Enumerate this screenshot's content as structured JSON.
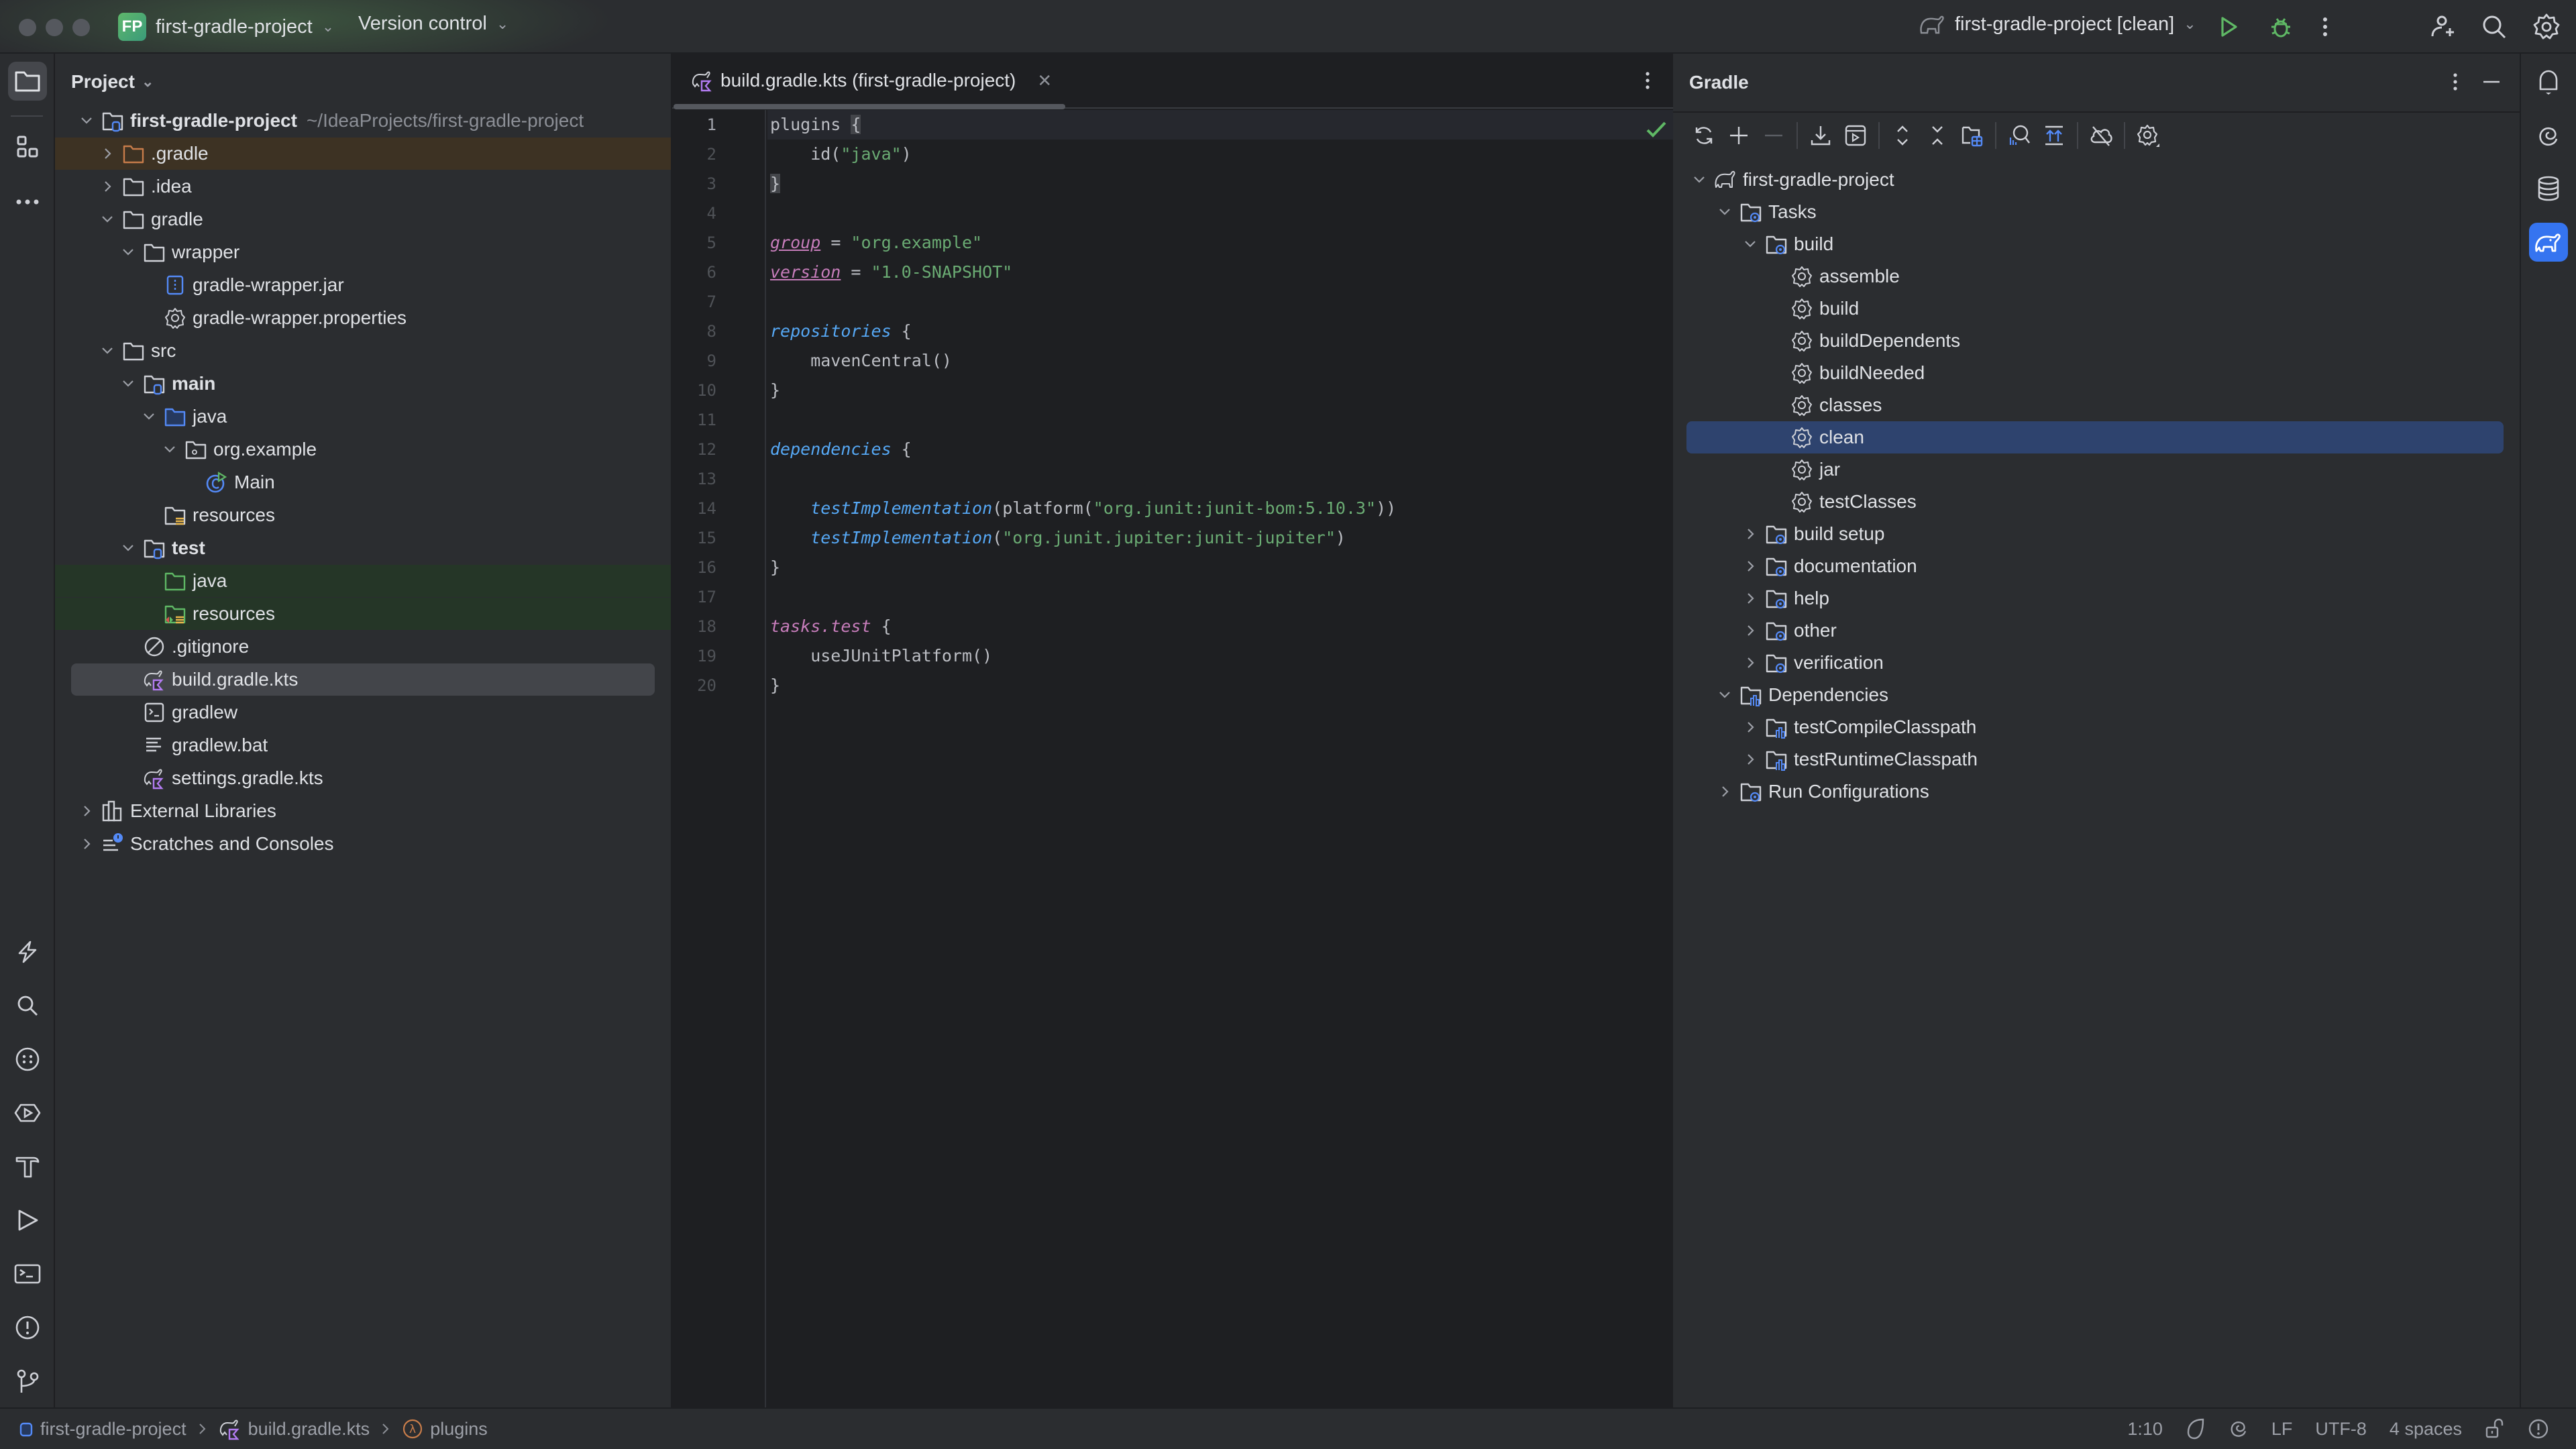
{
  "titlebar": {
    "project_badge": "FP",
    "project_name": "first-gradle-project",
    "vcs_label": "Version control",
    "run_config": "first-gradle-project [clean]",
    "colors": {
      "run": "#5fb865",
      "debug": "#5fb865"
    }
  },
  "left_stripe": {
    "top": [
      "project-icon",
      "structure-icon",
      "more-icon"
    ],
    "bottom": [
      "lightning-icon",
      "search-icon",
      "services-icon",
      "run-services-icon",
      "build-icon",
      "run-icon",
      "terminal-icon",
      "problems-icon",
      "git-icon"
    ]
  },
  "project_panel": {
    "title": "Project",
    "tree": [
      {
        "label": "first-gradle-project",
        "hint": "~/IdeaProjects/first-gradle-project",
        "level": 0,
        "arrow": "down",
        "icon": "module-folder",
        "bold": true
      },
      {
        "label": ".gradle",
        "level": 1,
        "arrow": "right",
        "icon": "folder-excluded",
        "state": "excluded"
      },
      {
        "label": ".idea",
        "level": 1,
        "arrow": "right",
        "icon": "folder"
      },
      {
        "label": "gradle",
        "level": 1,
        "arrow": "down",
        "icon": "folder"
      },
      {
        "label": "wrapper",
        "level": 2,
        "arrow": "down",
        "icon": "folder"
      },
      {
        "label": "gradle-wrapper.jar",
        "level": 3,
        "arrow": "",
        "icon": "jar"
      },
      {
        "label": "gradle-wrapper.properties",
        "level": 3,
        "arrow": "",
        "icon": "gear"
      },
      {
        "label": "src",
        "level": 1,
        "arrow": "down",
        "icon": "folder"
      },
      {
        "label": "main",
        "level": 2,
        "arrow": "down",
        "icon": "module-folder",
        "bold": true
      },
      {
        "label": "java",
        "level": 3,
        "arrow": "down",
        "icon": "folder-source"
      },
      {
        "label": "org.example",
        "level": 4,
        "arrow": "down",
        "icon": "package"
      },
      {
        "label": "Main",
        "level": 5,
        "arrow": "",
        "icon": "class"
      },
      {
        "label": "resources",
        "level": 3,
        "arrow": "",
        "icon": "folder-resources"
      },
      {
        "label": "test",
        "level": 2,
        "arrow": "down",
        "icon": "module-folder",
        "bold": true
      },
      {
        "label": "java",
        "level": 3,
        "arrow": "",
        "icon": "folder-test",
        "state": "test"
      },
      {
        "label": "resources",
        "level": 3,
        "arrow": "",
        "icon": "folder-test-resources",
        "state": "test"
      },
      {
        "label": ".gitignore",
        "level": 2,
        "arrow": "",
        "icon": "ignore"
      },
      {
        "label": "build.gradle.kts",
        "level": 2,
        "arrow": "",
        "icon": "gradle-kts",
        "state": "selected"
      },
      {
        "label": "gradlew",
        "level": 2,
        "arrow": "",
        "icon": "shell"
      },
      {
        "label": "gradlew.bat",
        "level": 2,
        "arrow": "",
        "icon": "text"
      },
      {
        "label": "settings.gradle.kts",
        "level": 2,
        "arrow": "",
        "icon": "gradle-kts"
      },
      {
        "label": "External Libraries",
        "level": 0,
        "arrow": "right",
        "icon": "libraries"
      },
      {
        "label": "Scratches and Consoles",
        "level": 0,
        "arrow": "right",
        "icon": "scratches"
      }
    ]
  },
  "editor": {
    "tab_label": "build.gradle.kts (first-gradle-project)",
    "current_line": 1,
    "lines": [
      [
        {
          "t": "plugins ",
          "c": "kw-default"
        },
        {
          "t": "{",
          "c": "kw-default brace-hl"
        }
      ],
      [
        {
          "t": "    id(",
          "c": "kw-default"
        },
        {
          "t": "\"java\"",
          "c": "str"
        },
        {
          "t": ")",
          "c": "kw-default"
        }
      ],
      [
        {
          "t": "}",
          "c": "kw-default brace-hl"
        }
      ],
      [],
      [
        {
          "t": "group",
          "c": "prop-pink"
        },
        {
          "t": " = ",
          "c": "kw-default"
        },
        {
          "t": "\"org.example\"",
          "c": "str"
        }
      ],
      [
        {
          "t": "version",
          "c": "prop-pink"
        },
        {
          "t": " = ",
          "c": "kw-default"
        },
        {
          "t": "\"1.0-SNAPSHOT\"",
          "c": "str"
        }
      ],
      [],
      [
        {
          "t": "repositories",
          "c": "fn-blue"
        },
        {
          "t": " {",
          "c": "kw-default"
        }
      ],
      [
        {
          "t": "    mavenCentral()",
          "c": "kw-default"
        }
      ],
      [
        {
          "t": "}",
          "c": "kw-default"
        }
      ],
      [],
      [
        {
          "t": "dependencies",
          "c": "fn-blue"
        },
        {
          "t": " {",
          "c": "kw-default"
        }
      ],
      [],
      [
        {
          "t": "    ",
          "c": "kw-default"
        },
        {
          "t": "testImplementation",
          "c": "fn-blue"
        },
        {
          "t": "(platform(",
          "c": "kw-default"
        },
        {
          "t": "\"org.junit:junit-bom:5.10.3\"",
          "c": "str"
        },
        {
          "t": "))",
          "c": "kw-default"
        }
      ],
      [
        {
          "t": "    ",
          "c": "kw-default"
        },
        {
          "t": "testImplementation",
          "c": "fn-blue"
        },
        {
          "t": "(",
          "c": "kw-default"
        },
        {
          "t": "\"org.junit.jupiter:junit-jupiter\"",
          "c": "str"
        },
        {
          "t": ")",
          "c": "kw-default"
        }
      ],
      [
        {
          "t": "}",
          "c": "kw-default"
        }
      ],
      [],
      [
        {
          "t": "tasks.test",
          "c": "pink-it"
        },
        {
          "t": " {",
          "c": "kw-default"
        }
      ],
      [
        {
          "t": "    useJUnitPlatform()",
          "c": "kw-default"
        }
      ],
      [
        {
          "t": "}",
          "c": "kw-default"
        }
      ]
    ],
    "inspection_status": "ok-check"
  },
  "gradle_panel": {
    "title": "Gradle",
    "toolbar": [
      "reload-icon",
      "add-icon",
      "remove-icon",
      "|",
      "download-sources-icon",
      "run-task-icon",
      "|",
      "expand-all-icon",
      "collapse-all-icon",
      "group-modules-icon",
      "|",
      "analyze-deps-icon",
      "toggle-offline-icon",
      "|",
      "offline-cloud-icon",
      "|",
      "settings-icon"
    ],
    "tree": [
      {
        "label": "first-gradle-project",
        "level": 0,
        "arrow": "down",
        "icon": "gradle"
      },
      {
        "label": "Tasks",
        "level": 1,
        "arrow": "down",
        "icon": "task-folder"
      },
      {
        "label": "build",
        "level": 2,
        "arrow": "down",
        "icon": "task-folder"
      },
      {
        "label": "assemble",
        "level": 3,
        "arrow": "",
        "icon": "task"
      },
      {
        "label": "build",
        "level": 3,
        "arrow": "",
        "icon": "task"
      },
      {
        "label": "buildDependents",
        "level": 3,
        "arrow": "",
        "icon": "task"
      },
      {
        "label": "buildNeeded",
        "level": 3,
        "arrow": "",
        "icon": "task"
      },
      {
        "label": "classes",
        "level": 3,
        "arrow": "",
        "icon": "task"
      },
      {
        "label": "clean",
        "level": 3,
        "arrow": "",
        "icon": "task",
        "state": "selected"
      },
      {
        "label": "jar",
        "level": 3,
        "arrow": "",
        "icon": "task"
      },
      {
        "label": "testClasses",
        "level": 3,
        "arrow": "",
        "icon": "task"
      },
      {
        "label": "build setup",
        "level": 2,
        "arrow": "right",
        "icon": "task-folder"
      },
      {
        "label": "documentation",
        "level": 2,
        "arrow": "right",
        "icon": "task-folder"
      },
      {
        "label": "help",
        "level": 2,
        "arrow": "right",
        "icon": "task-folder"
      },
      {
        "label": "other",
        "level": 2,
        "arrow": "right",
        "icon": "task-folder"
      },
      {
        "label": "verification",
        "level": 2,
        "arrow": "right",
        "icon": "task-folder"
      },
      {
        "label": "Dependencies",
        "level": 1,
        "arrow": "down",
        "icon": "deps-folder"
      },
      {
        "label": "testCompileClasspath",
        "level": 2,
        "arrow": "right",
        "icon": "deps-folder"
      },
      {
        "label": "testRuntimeClasspath",
        "level": 2,
        "arrow": "right",
        "icon": "deps-folder"
      },
      {
        "label": "Run Configurations",
        "level": 1,
        "arrow": "right",
        "icon": "task-folder"
      }
    ]
  },
  "right_stripe": [
    "notifications-icon",
    "ai-assistant-icon",
    "database-icon",
    "gradle-icon"
  ],
  "statusbar": {
    "breadcrumbs": [
      {
        "label": "first-gradle-project",
        "icon": "module-icon"
      },
      {
        "label": "build.gradle.kts",
        "icon": "gradle-kts-icon"
      },
      {
        "label": "plugins",
        "icon": "lambda-icon"
      }
    ],
    "caret": "1:10",
    "line_sep": "LF",
    "encoding": "UTF-8",
    "indent": "4 spaces"
  }
}
